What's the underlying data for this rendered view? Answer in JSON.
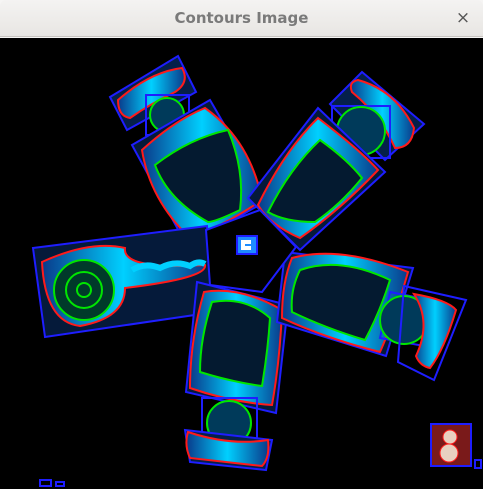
{
  "window": {
    "title": "Contours Image",
    "close_glyph": "×",
    "close_icon": "close-icon"
  },
  "canvas": {
    "background": "#000000",
    "contour_colors": {
      "outer": "#ff1a1a",
      "inner": "#00e600",
      "bounding_box": "#1e1eff",
      "fill": "#00c8ff"
    }
  }
}
